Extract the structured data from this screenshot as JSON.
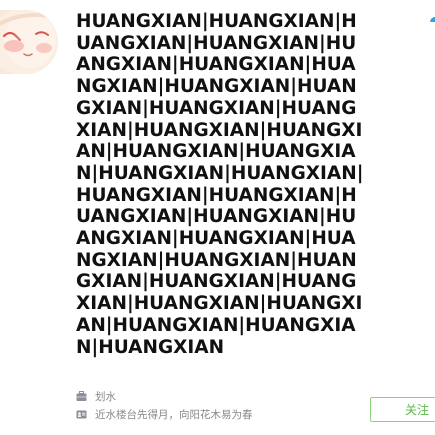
{
  "profile": {
    "name": "HUANGXIAN|HUANGXIAN|HUANGXIAN|HUANGXIAN|HUANGXIAN|HUANGXIAN|HUANGXIAN|HUANGXIAN|HUANGXIAN|HUANGXIAN|HUANGXIAN|HUANGXIAN|HUANGXIAN|HUANGXIAN|HUANGXIAN|HUANGXIAN|HUANGXIAN|HUANGXIAN|HUANGXIAN|HUANGXIAN|HUANGXIAN|HUANGXIAN|HUANGXIAN|HUANGXIAN|HUANGXIAN|HUANGXIAN|HUANGXIAN|HUANGXIAN|HUANGXIAN|HUANGXIAN|HUANGXIAN|HUANGXIAN|HUANGXIAN",
    "occupation": "划水",
    "bio": "近水楼台先得月，向阳花木易为春",
    "avatar_icon": "cartoon-face-avatar",
    "occupation_icon": "briefcase-icon",
    "bio_icon": "id-card-icon"
  },
  "actions": {
    "follow_label": "关注"
  },
  "colors": {
    "follow_border": "#8bd37a",
    "follow_text": "#5cb84a",
    "meta_text": "#888888",
    "name_text": "#111111"
  }
}
